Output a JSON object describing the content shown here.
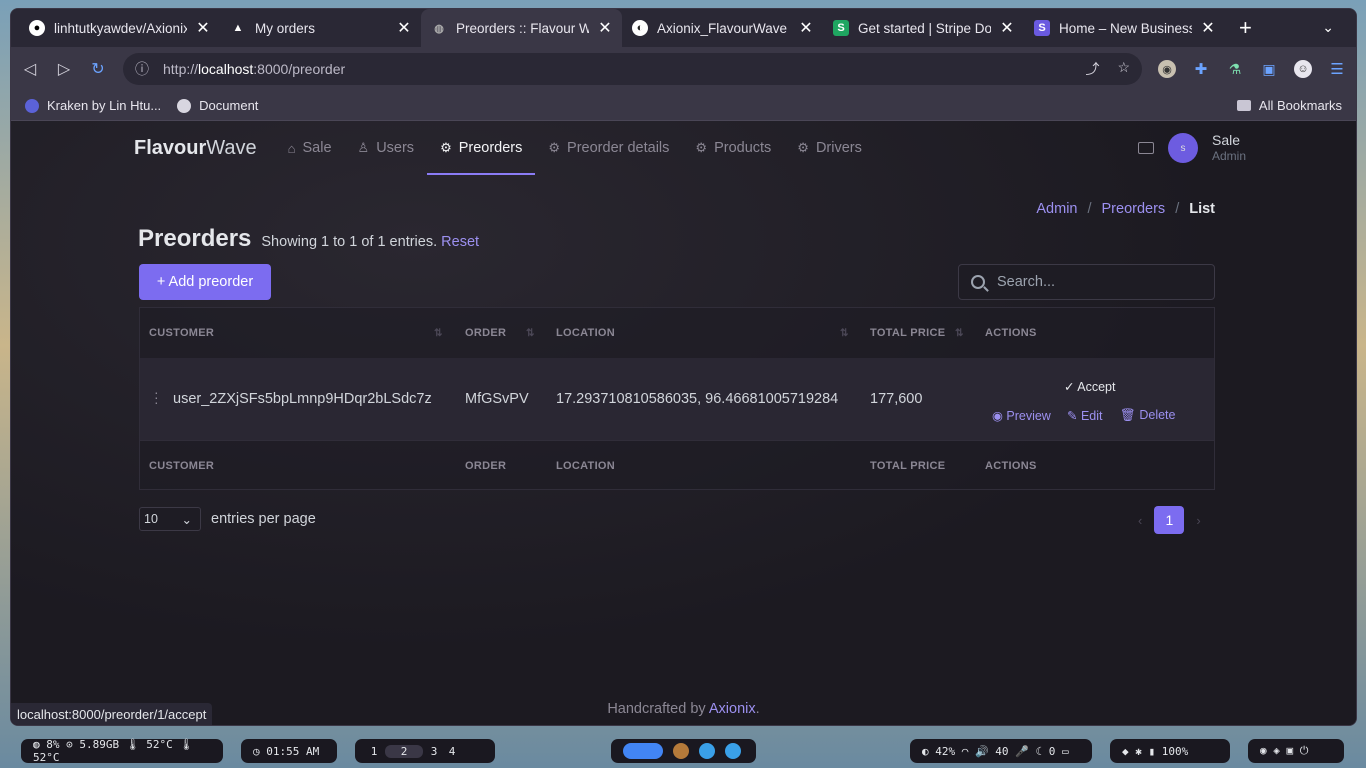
{
  "browser": {
    "tabs": [
      {
        "title": "linhtutkyawdev/Axionix_",
        "fav": "github"
      },
      {
        "title": "My orders",
        "fav": "triangle"
      },
      {
        "title": "Preorders :: Flavour Wa",
        "fav": "globe"
      },
      {
        "title": "Axionix_FlavourWave |",
        "fav": "globe-dark"
      },
      {
        "title": "Get started | Stripe Doc",
        "fav": "S"
      },
      {
        "title": "Home – New Business",
        "fav": "S"
      }
    ],
    "url_scheme": "http://",
    "url_host": "localhost",
    "url_rest": ":8000/preorder",
    "bookmarks": [
      {
        "label": "Kraken by Lin Htu..."
      },
      {
        "label": "Document"
      }
    ],
    "all_bookmarks": "All Bookmarks",
    "status_url": "localhost:8000/preorder/1/accept"
  },
  "app": {
    "brand_bold": "Flavour",
    "brand_light": "Wave",
    "nav": [
      {
        "label": "Sale"
      },
      {
        "label": "Users"
      },
      {
        "label": "Preorders"
      },
      {
        "label": "Preorder details"
      },
      {
        "label": "Products"
      },
      {
        "label": "Drivers"
      }
    ],
    "user": {
      "initial": "s",
      "name": "Sale",
      "role": "Admin"
    },
    "breadcrumb": {
      "admin": "Admin",
      "preorders": "Preorders",
      "current": "List"
    },
    "page_title": "Preorders",
    "showing": "Showing 1 to 1 of 1 entries.",
    "reset": "Reset",
    "add_button": "+ Add preorder",
    "search_placeholder": "Search...",
    "columns": [
      "CUSTOMER",
      "ORDER",
      "LOCATION",
      "TOTAL PRICE",
      "ACTIONS"
    ],
    "rows": [
      {
        "customer": "user_2ZXjSFs5bpLmnp9HDqr2bLSdc7z",
        "order": "MfGSvPV",
        "location": "17.293710810586035, 96.46681005719284",
        "total_price": "177,600"
      }
    ],
    "actions": {
      "accept": "✓ Accept",
      "preview": "◉ Preview",
      "edit": "✎ Edit",
      "delete": "🗑 Delete"
    },
    "per_page_value": "10",
    "per_page_label": "entries per page",
    "current_page": "1",
    "footer_prefix": "Handcrafted by",
    "footer_link": "Axionix",
    "footer_suffix": "."
  },
  "taskbar": {
    "stats": "◍ 8%  ⊙ 5.89GB  🌡 52°C  🌡 52°C",
    "clock": "◷ 01:55 AM",
    "workspaces": [
      "1",
      "2",
      "3",
      "4"
    ],
    "system": "◐ 42%  ◠  🔊 40  🎤  ☾ 0  ▭",
    "battery": "◆  ✱  ▮ 100%"
  }
}
